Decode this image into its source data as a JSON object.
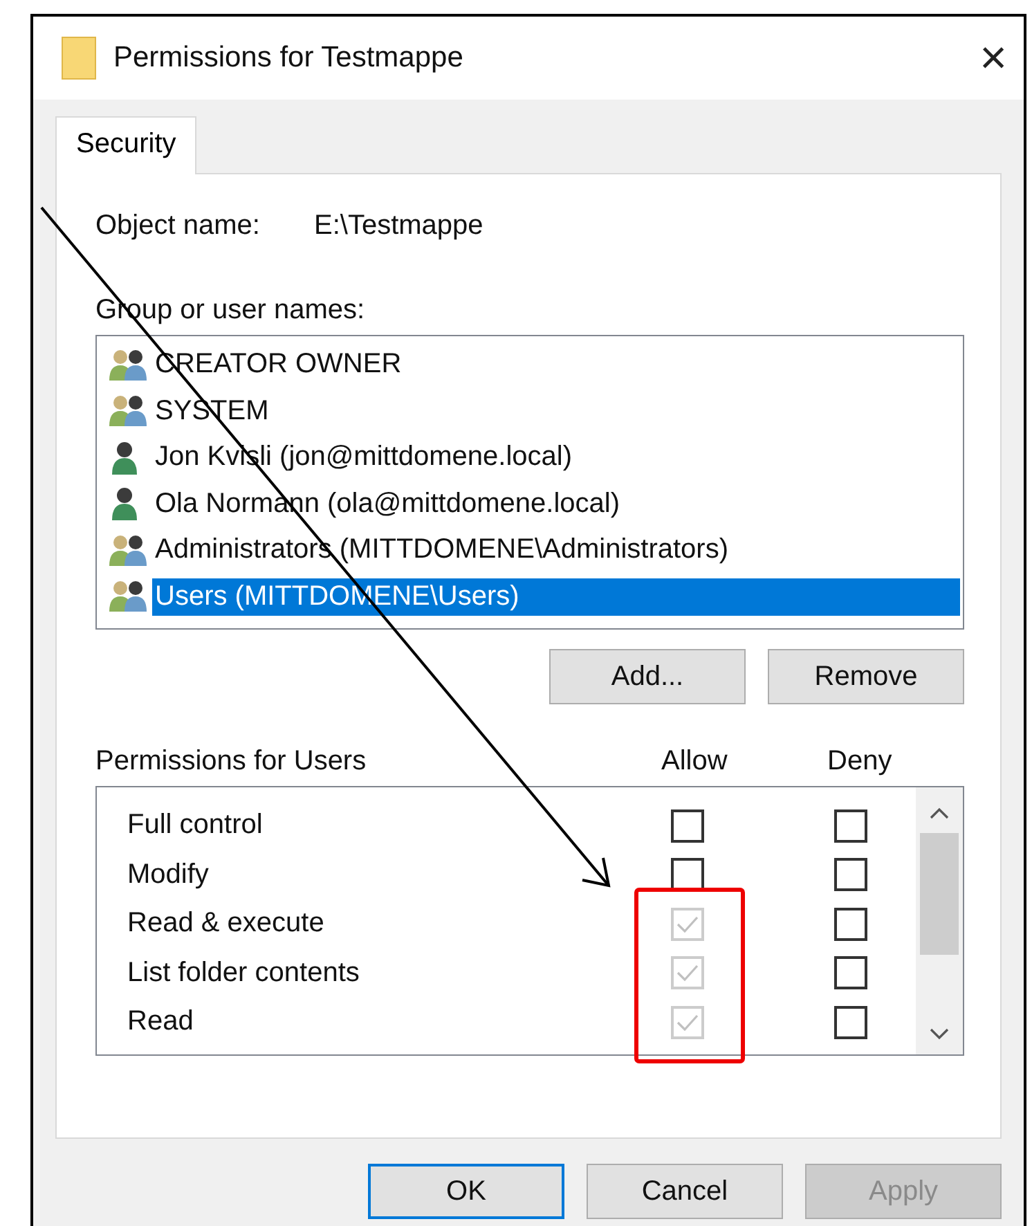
{
  "window": {
    "title": "Permissions for Testmappe",
    "close": "×"
  },
  "tabs": [
    {
      "label": "Security",
      "selected": true
    }
  ],
  "object_name": {
    "label": "Object name:",
    "value": "E:\\Testmappe"
  },
  "group_list": {
    "label": "Group or user names:",
    "items": [
      {
        "name": "CREATOR OWNER",
        "kind": "group",
        "selected": false
      },
      {
        "name": "SYSTEM",
        "kind": "group",
        "selected": false
      },
      {
        "name": "Jon Kvisli (jon@mittdomene.local)",
        "kind": "user",
        "selected": false
      },
      {
        "name": "Ola Normann (ola@mittdomene.local)",
        "kind": "user",
        "selected": false
      },
      {
        "name": "Administrators (MITTDOMENE\\Administrators)",
        "kind": "group",
        "selected": false
      },
      {
        "name": "Users (MITTDOMENE\\Users)",
        "kind": "group",
        "selected": true
      }
    ]
  },
  "list_buttons": [
    "Add...",
    "Remove"
  ],
  "permissions": {
    "label": "Permissions for Users",
    "columns": [
      "Allow",
      "Deny"
    ],
    "rows": [
      {
        "name": "Full control",
        "allow": {
          "checked": false,
          "disabled": false
        },
        "deny": {
          "checked": false,
          "disabled": false
        }
      },
      {
        "name": "Modify",
        "allow": {
          "checked": false,
          "disabled": false
        },
        "deny": {
          "checked": false,
          "disabled": false
        }
      },
      {
        "name": "Read & execute",
        "allow": {
          "checked": true,
          "disabled": true
        },
        "deny": {
          "checked": false,
          "disabled": false
        }
      },
      {
        "name": "List folder contents",
        "allow": {
          "checked": true,
          "disabled": true
        },
        "deny": {
          "checked": false,
          "disabled": false
        }
      },
      {
        "name": "Read",
        "allow": {
          "checked": true,
          "disabled": true
        },
        "deny": {
          "checked": false,
          "disabled": false
        }
      }
    ]
  },
  "buttons": [
    {
      "label": "OK",
      "focused": true,
      "disabled": false
    },
    {
      "label": "Cancel",
      "focused": false,
      "disabled": false
    },
    {
      "label": "Apply",
      "focused": false,
      "disabled": true
    }
  ]
}
